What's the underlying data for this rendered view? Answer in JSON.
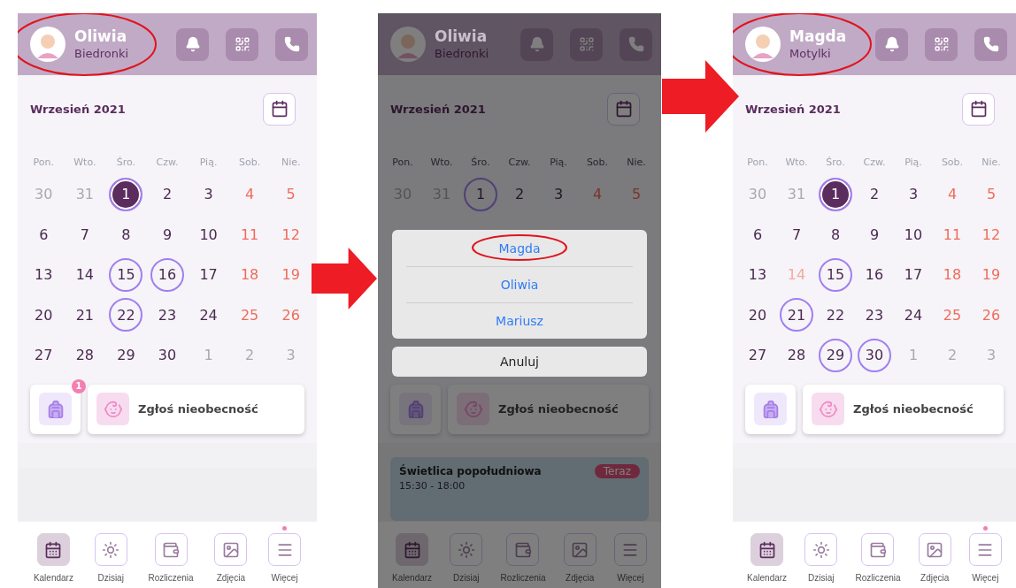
{
  "screens": [
    {
      "header": {
        "name": "Oliwia",
        "group": "Biedronki",
        "highlighted": true
      },
      "month": "Wrzesień 2021",
      "weekdays": [
        "Pon.",
        "Wto.",
        "Śro.",
        "Czw.",
        "Pią.",
        "Sob.",
        "Nie."
      ],
      "days": [
        {
          "day": "30",
          "kind": "muted",
          "circled": false,
          "selected": false
        },
        {
          "day": "31",
          "kind": "muted",
          "circled": false,
          "selected": false
        },
        {
          "day": "1",
          "kind": "normal",
          "circled": true,
          "selected": true
        },
        {
          "day": "2",
          "kind": "normal",
          "circled": false,
          "selected": false
        },
        {
          "day": "3",
          "kind": "normal",
          "circled": false,
          "selected": false
        },
        {
          "day": "4",
          "kind": "weekend",
          "circled": false,
          "selected": false
        },
        {
          "day": "5",
          "kind": "weekend",
          "circled": false,
          "selected": false
        },
        {
          "day": "6",
          "kind": "normal",
          "circled": false,
          "selected": false
        },
        {
          "day": "7",
          "kind": "normal",
          "circled": false,
          "selected": false
        },
        {
          "day": "8",
          "kind": "normal",
          "circled": false,
          "selected": false
        },
        {
          "day": "9",
          "kind": "normal",
          "circled": false,
          "selected": false
        },
        {
          "day": "10",
          "kind": "normal",
          "circled": false,
          "selected": false
        },
        {
          "day": "11",
          "kind": "weekend",
          "circled": false,
          "selected": false
        },
        {
          "day": "12",
          "kind": "weekend",
          "circled": false,
          "selected": false
        },
        {
          "day": "13",
          "kind": "normal",
          "circled": false,
          "selected": false
        },
        {
          "day": "14",
          "kind": "normal",
          "circled": false,
          "selected": false
        },
        {
          "day": "15",
          "kind": "normal",
          "circled": true,
          "selected": false
        },
        {
          "day": "16",
          "kind": "normal",
          "circled": true,
          "selected": false
        },
        {
          "day": "17",
          "kind": "normal",
          "circled": false,
          "selected": false
        },
        {
          "day": "18",
          "kind": "weekend",
          "circled": false,
          "selected": false
        },
        {
          "day": "19",
          "kind": "weekend",
          "circled": false,
          "selected": false
        },
        {
          "day": "20",
          "kind": "normal",
          "circled": false,
          "selected": false
        },
        {
          "day": "21",
          "kind": "normal",
          "circled": false,
          "selected": false
        },
        {
          "day": "22",
          "kind": "normal",
          "circled": true,
          "selected": false
        },
        {
          "day": "23",
          "kind": "normal",
          "circled": false,
          "selected": false
        },
        {
          "day": "24",
          "kind": "normal",
          "circled": false,
          "selected": false
        },
        {
          "day": "25",
          "kind": "weekend",
          "circled": false,
          "selected": false
        },
        {
          "day": "26",
          "kind": "weekend",
          "circled": false,
          "selected": false
        },
        {
          "day": "27",
          "kind": "normal",
          "circled": false,
          "selected": false
        },
        {
          "day": "28",
          "kind": "normal",
          "circled": false,
          "selected": false
        },
        {
          "day": "29",
          "kind": "normal",
          "circled": false,
          "selected": false
        },
        {
          "day": "30",
          "kind": "normal",
          "circled": false,
          "selected": false
        },
        {
          "day": "1",
          "kind": "muted",
          "circled": false,
          "selected": false
        },
        {
          "day": "2",
          "kind": "muted",
          "circled": false,
          "selected": false
        },
        {
          "day": "3",
          "kind": "muted",
          "circled": false,
          "selected": false
        }
      ],
      "tiles": {
        "badge": "1",
        "absence": "Zgłoś nieobecność"
      },
      "nav": [
        {
          "label": "Kalendarz",
          "selected": true,
          "dot": false
        },
        {
          "label": "Dzisiaj",
          "selected": false,
          "dot": false
        },
        {
          "label": "Rozliczenia",
          "selected": false,
          "dot": false
        },
        {
          "label": "Zdjęcia",
          "selected": false,
          "dot": false
        },
        {
          "label": "Więcej",
          "selected": false,
          "dot": true
        }
      ]
    },
    {
      "dimmed": true,
      "header": {
        "name": "Oliwia",
        "group": "Biedronki",
        "highlighted": false
      },
      "month": "Wrzesień 2021",
      "weekdays": [
        "Pon.",
        "Wto.",
        "Śro.",
        "Czw.",
        "Pią.",
        "Sob.",
        "Nie."
      ],
      "days": [
        {
          "day": "30",
          "kind": "muted",
          "circled": false,
          "selected": false
        },
        {
          "day": "31",
          "kind": "muted",
          "circled": false,
          "selected": false
        },
        {
          "day": "1",
          "kind": "normal",
          "circled": true,
          "selected": false
        },
        {
          "day": "2",
          "kind": "normal",
          "circled": false,
          "selected": false
        },
        {
          "day": "3",
          "kind": "normal",
          "circled": false,
          "selected": false
        },
        {
          "day": "4",
          "kind": "weekend",
          "circled": false,
          "selected": false
        },
        {
          "day": "5",
          "kind": "weekend",
          "circled": false,
          "selected": false
        }
      ],
      "tiles": {
        "absence": "Zgłoś nieobecność"
      },
      "event": {
        "title": "Świetlica popołudniowa",
        "time": "15:30 - 18:00",
        "badge": "Teraz"
      },
      "nav": [
        {
          "label": "Kalendarz",
          "selected": true
        },
        {
          "label": "Dzisiaj",
          "selected": false
        },
        {
          "label": "Rozliczenia",
          "selected": false
        },
        {
          "label": "Zdjęcia",
          "selected": false
        },
        {
          "label": "Więcej",
          "selected": false
        }
      ],
      "action_sheet": {
        "options": [
          {
            "label": "Magda",
            "highlighted": true
          },
          {
            "label": "Oliwia",
            "highlighted": false
          },
          {
            "label": "Mariusz",
            "highlighted": false
          }
        ],
        "cancel": "Anuluj"
      }
    },
    {
      "header": {
        "name": "Magda",
        "group": "Motylki",
        "highlighted": true
      },
      "month": "Wrzesień 2021",
      "weekdays": [
        "Pon.",
        "Wto.",
        "Śro.",
        "Czw.",
        "Pią.",
        "Sob.",
        "Nie."
      ],
      "days": [
        {
          "day": "30",
          "kind": "muted",
          "circled": false,
          "selected": false
        },
        {
          "day": "31",
          "kind": "muted",
          "circled": false,
          "selected": false
        },
        {
          "day": "1",
          "kind": "normal",
          "circled": true,
          "selected": true
        },
        {
          "day": "2",
          "kind": "normal",
          "circled": false,
          "selected": false
        },
        {
          "day": "3",
          "kind": "normal",
          "circled": false,
          "selected": false
        },
        {
          "day": "4",
          "kind": "weekend",
          "circled": false,
          "selected": false
        },
        {
          "day": "5",
          "kind": "weekend",
          "circled": false,
          "selected": false
        },
        {
          "day": "6",
          "kind": "normal",
          "circled": false,
          "selected": false
        },
        {
          "day": "7",
          "kind": "normal",
          "circled": false,
          "selected": false
        },
        {
          "day": "8",
          "kind": "normal",
          "circled": false,
          "selected": false
        },
        {
          "day": "9",
          "kind": "normal",
          "circled": false,
          "selected": false
        },
        {
          "day": "10",
          "kind": "normal",
          "circled": false,
          "selected": false
        },
        {
          "day": "11",
          "kind": "weekend",
          "circled": false,
          "selected": false
        },
        {
          "day": "12",
          "kind": "weekend",
          "circled": false,
          "selected": false
        },
        {
          "day": "13",
          "kind": "normal",
          "circled": false,
          "selected": false
        },
        {
          "day": "14",
          "kind": "holiday",
          "circled": false,
          "selected": false
        },
        {
          "day": "15",
          "kind": "normal",
          "circled": true,
          "selected": false
        },
        {
          "day": "16",
          "kind": "normal",
          "circled": false,
          "selected": false
        },
        {
          "day": "17",
          "kind": "normal",
          "circled": false,
          "selected": false
        },
        {
          "day": "18",
          "kind": "weekend",
          "circled": false,
          "selected": false
        },
        {
          "day": "19",
          "kind": "weekend",
          "circled": false,
          "selected": false
        },
        {
          "day": "20",
          "kind": "normal",
          "circled": false,
          "selected": false
        },
        {
          "day": "21",
          "kind": "normal",
          "circled": true,
          "selected": false
        },
        {
          "day": "22",
          "kind": "normal",
          "circled": false,
          "selected": false
        },
        {
          "day": "23",
          "kind": "normal",
          "circled": false,
          "selected": false
        },
        {
          "day": "24",
          "kind": "normal",
          "circled": false,
          "selected": false
        },
        {
          "day": "25",
          "kind": "weekend",
          "circled": false,
          "selected": false
        },
        {
          "day": "26",
          "kind": "weekend",
          "circled": false,
          "selected": false
        },
        {
          "day": "27",
          "kind": "normal",
          "circled": false,
          "selected": false
        },
        {
          "day": "28",
          "kind": "normal",
          "circled": false,
          "selected": false
        },
        {
          "day": "29",
          "kind": "normal",
          "circled": true,
          "selected": false
        },
        {
          "day": "30",
          "kind": "normal",
          "circled": true,
          "selected": false
        },
        {
          "day": "1",
          "kind": "muted",
          "circled": false,
          "selected": false
        },
        {
          "day": "2",
          "kind": "muted",
          "circled": false,
          "selected": false
        },
        {
          "day": "3",
          "kind": "muted",
          "circled": false,
          "selected": false
        }
      ],
      "tiles": {
        "absence": "Zgłoś nieobecność"
      },
      "nav": [
        {
          "label": "Kalendarz",
          "selected": true,
          "dot": false
        },
        {
          "label": "Dzisiaj",
          "selected": false,
          "dot": false
        },
        {
          "label": "Rozliczenia",
          "selected": false,
          "dot": false
        },
        {
          "label": "Zdjęcia",
          "selected": false,
          "dot": false
        },
        {
          "label": "Więcej",
          "selected": false,
          "dot": true
        }
      ]
    }
  ]
}
